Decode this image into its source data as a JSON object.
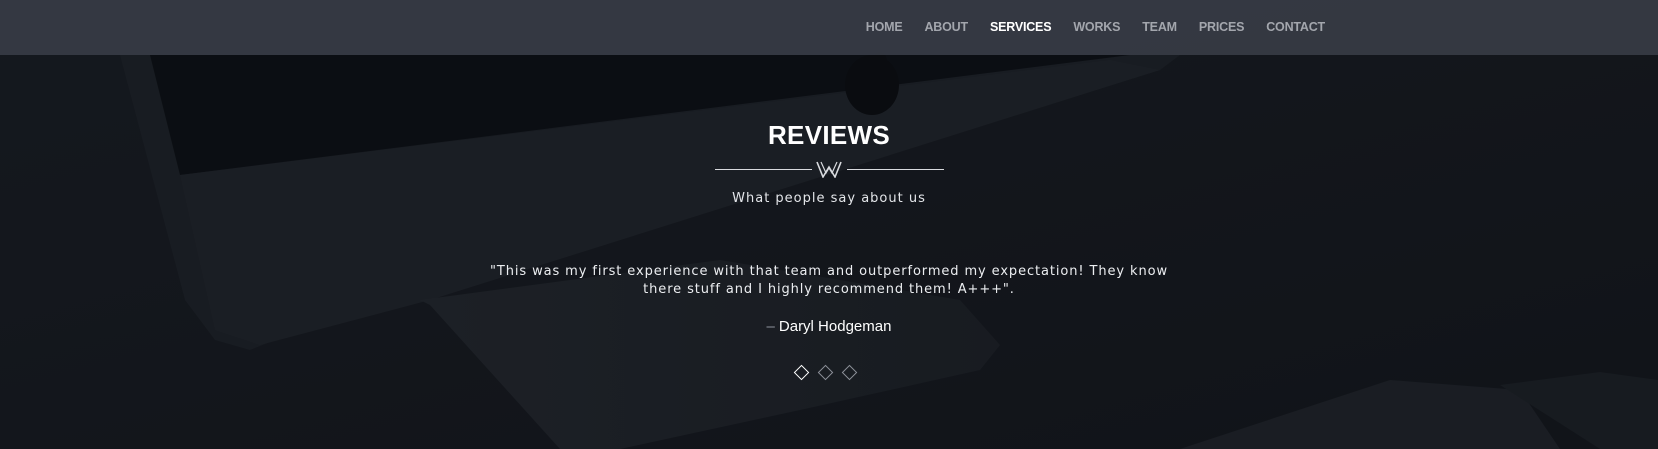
{
  "nav": {
    "items": [
      {
        "label": "HOME",
        "active": false
      },
      {
        "label": "ABOUT",
        "active": false
      },
      {
        "label": "SERVICES",
        "active": true
      },
      {
        "label": "WORKS",
        "active": false
      },
      {
        "label": "TEAM",
        "active": false
      },
      {
        "label": "PRICES",
        "active": false
      },
      {
        "label": "CONTACT",
        "active": false
      }
    ]
  },
  "reviews": {
    "title": "REVIEWS",
    "subtitle": "What people say about us",
    "divider_icon": "w-logo-icon",
    "quote": "\"This was my first experience with that team and outperformed my expectation! They know there stuff and I highly recommend them! A+++\".",
    "author_dash": "–",
    "author": "Daryl Hodgeman",
    "slides": 3,
    "active_slide": 1
  },
  "colors": {
    "navbar": "#363a43",
    "nav_text": "#a3a6ad",
    "nav_active": "#ffffff",
    "background": "#171b21",
    "text": "#ffffff"
  }
}
